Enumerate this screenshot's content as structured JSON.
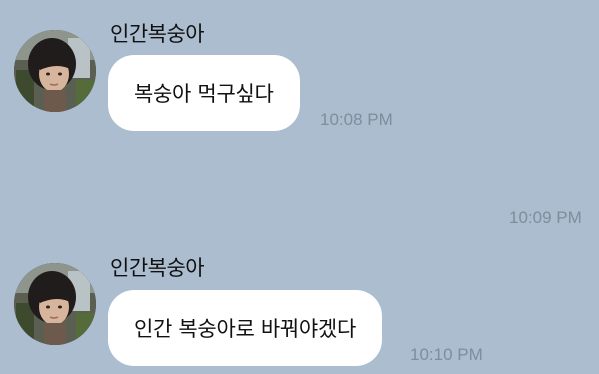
{
  "messages": [
    {
      "sender": "인간복숭아",
      "text": "복숭아 먹구싶다",
      "time": "10:08 PM",
      "avatar_icon": "profile-photo"
    },
    {
      "time": "10:09 PM"
    },
    {
      "sender": "인간복숭아",
      "text": "인간 복숭아로 바꿔야겠다",
      "time": "10:10 PM",
      "avatar_icon": "profile-photo"
    }
  ],
  "colors": {
    "background": "#abbdcf",
    "bubble": "#ffffff",
    "timestamp": "#7f8d9c"
  }
}
